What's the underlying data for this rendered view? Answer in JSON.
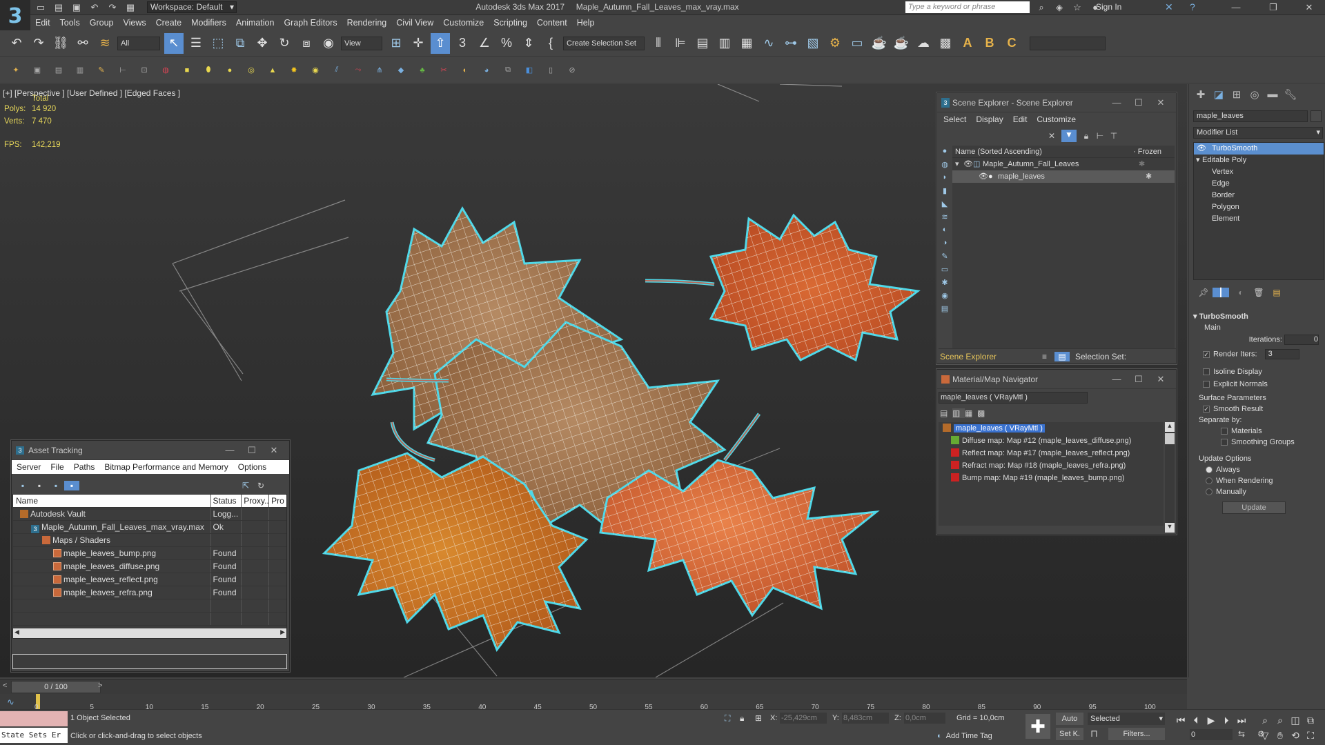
{
  "titlebar": {
    "workspace": "Workspace: Default",
    "app_title": "Autodesk 3ds Max 2017",
    "file_title": "Maple_Autumn_Fall_Leaves_max_vray.max",
    "search_placeholder": "Type a keyword or phrase",
    "sign_in": "Sign In"
  },
  "menubar": [
    "Edit",
    "Tools",
    "Group",
    "Views",
    "Create",
    "Modifiers",
    "Animation",
    "Graph Editors",
    "Rendering",
    "Civil View",
    "Customize",
    "Scripting",
    "Content",
    "Help"
  ],
  "toolbar": {
    "filter_dropdown": "All",
    "view_dropdown": "View",
    "selection_set_dropdown": "Create Selection Set",
    "text_a": "A",
    "text_b": "B",
    "text_c": "C"
  },
  "viewport": {
    "label": "[+] [Perspective ] [User Defined ] [Edged Faces ]",
    "stats_total": "Total",
    "polys_label": "Polys:",
    "polys_value": "14 920",
    "verts_label": "Verts:",
    "verts_value": "7 470",
    "fps_label": "FPS:",
    "fps_value": "142,219"
  },
  "scene_explorer": {
    "title": "Scene Explorer - Scene Explorer",
    "menu": [
      "Select",
      "Display",
      "Edit",
      "Customize"
    ],
    "col_name": "Name (Sorted Ascending)",
    "col_frozen": "Frozen",
    "items": [
      "Maple_Autumn_Fall_Leaves",
      "maple_leaves"
    ],
    "footer_name": "Scene Explorer",
    "footer_selection": "Selection Set:"
  },
  "material_navigator": {
    "title": "Material/Map Navigator",
    "field": "maple_leaves  ( VRayMtl )",
    "root": "maple_leaves  ( VRayMtl )",
    "maps": [
      "Diffuse map: Map #12 (maple_leaves_diffuse.png)",
      "Reflect map: Map #17 (maple_leaves_reflect.png)",
      "Refract map: Map #18 (maple_leaves_refra.png)",
      "Bump map: Map #19 (maple_leaves_bump.png)"
    ]
  },
  "asset_tracking": {
    "title": "Asset Tracking",
    "menu": [
      "Server",
      "File",
      "Paths",
      "Bitmap Performance and Memory",
      "Options"
    ],
    "columns": [
      "Name",
      "Status",
      "Proxy...",
      "Pro"
    ],
    "rows": [
      {
        "name": "Autodesk Vault",
        "status": "Logg...",
        "indent": 0,
        "icon": "vault"
      },
      {
        "name": "Maple_Autumn_Fall_Leaves_max_vray.max",
        "status": "Ok",
        "indent": 1,
        "icon": "max"
      },
      {
        "name": "Maps / Shaders",
        "status": "",
        "indent": 2,
        "icon": "folder"
      },
      {
        "name": "maple_leaves_bump.png",
        "status": "Found",
        "indent": 3,
        "icon": "file"
      },
      {
        "name": "maple_leaves_diffuse.png",
        "status": "Found",
        "indent": 3,
        "icon": "file"
      },
      {
        "name": "maple_leaves_reflect.png",
        "status": "Found",
        "indent": 3,
        "icon": "file"
      },
      {
        "name": "maple_leaves_refra.png",
        "status": "Found",
        "indent": 3,
        "icon": "file"
      }
    ]
  },
  "command_panel": {
    "object_name": "maple_leaves",
    "modifier_list": "Modifier List",
    "stack": [
      "TurboSmooth",
      "Editable Poly",
      "Vertex",
      "Edge",
      "Border",
      "Polygon",
      "Element"
    ],
    "turbosmooth_title": "TurboSmooth",
    "main_label": "Main",
    "iterations_label": "Iterations:",
    "iterations_value": "0",
    "render_iters_label": "Render Iters:",
    "render_iters_value": "3",
    "isoline": "Isoline Display",
    "explicit_normals": "Explicit Normals",
    "surface_params": "Surface Parameters",
    "smooth_result": "Smooth Result",
    "separate_by": "Separate by:",
    "materials": "Materials",
    "smoothing_groups": "Smoothing Groups",
    "update_options": "Update Options",
    "always": "Always",
    "when_rendering": "When Rendering",
    "manually": "Manually",
    "update_button": "Update"
  },
  "timeline": {
    "frame_display": "0 / 100",
    "ticks": [
      "0",
      "5",
      "10",
      "15",
      "20",
      "25",
      "30",
      "35",
      "40",
      "45",
      "50",
      "55",
      "60",
      "65",
      "70",
      "75",
      "80",
      "85",
      "90",
      "95",
      "100"
    ]
  },
  "statusbar": {
    "state_sets": "State Sets Er",
    "selected": "1 Object Selected",
    "prompt": "Click or click-and-drag to select objects",
    "x_label": "X:",
    "x_value": "-25,429cm",
    "y_label": "Y:",
    "y_value": "8,483cm",
    "z_label": "Z:",
    "z_value": "0,0cm",
    "grid": "Grid = 10,0cm",
    "add_time_tag": "Add Time Tag",
    "auto": "Auto",
    "set_k": "Set K.",
    "selected_dropdown": "Selected",
    "filters": "Filters...",
    "frame_field": "0"
  },
  "colors": {
    "selection_highlight": "#4fd8e8",
    "stats_text": "#e8d85a",
    "selected_item": "#5b8fcf"
  }
}
